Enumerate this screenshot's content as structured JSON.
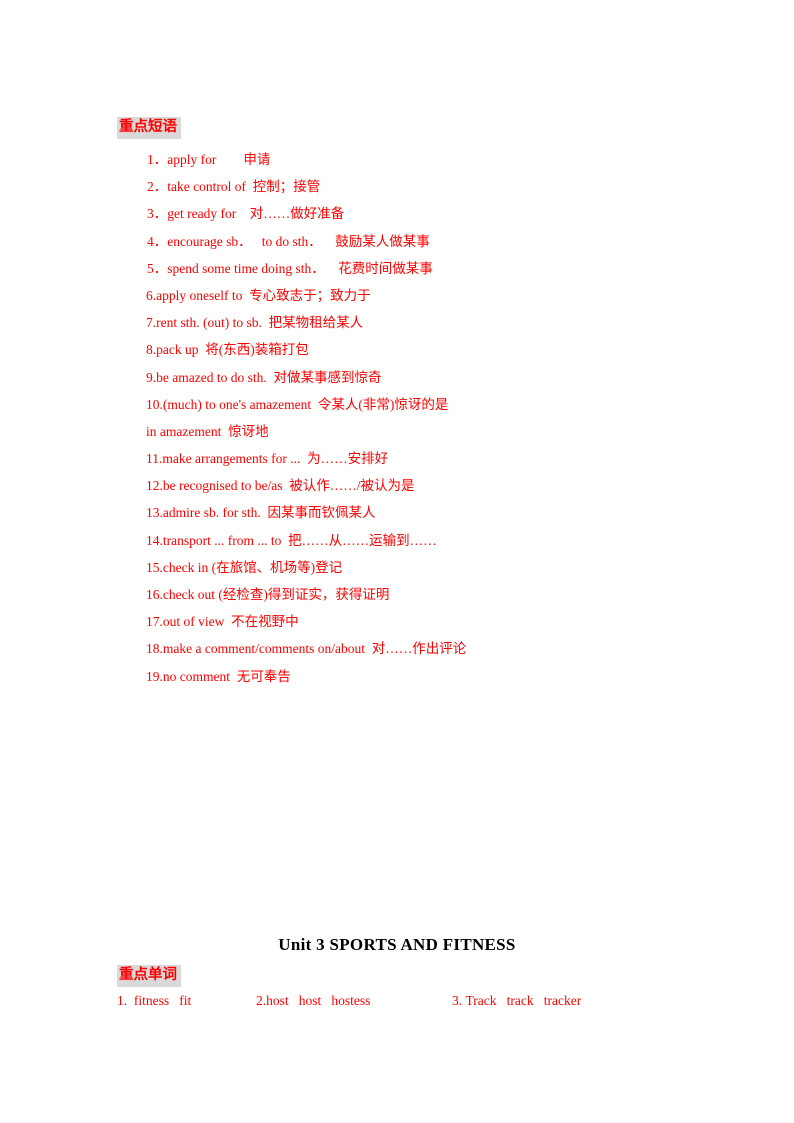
{
  "page": {
    "background": "#ffffff",
    "text_color": "#ff0000",
    "title_color": "#000000",
    "highlight_color": "#d9d9d9"
  },
  "phrases_section": {
    "heading": "重点短语",
    "items": [
      "1．apply for        申请",
      "2．take control of  控制；接管",
      "3．get ready for    对……做好准备",
      "4．encourage sb．   to do sth．    鼓励某人做某事",
      "5．spend some time doing sth．    花费时间做某事",
      "6.apply oneself to  专心致志于；致力于",
      "7.rent sth. (out) to sb.  把某物租给某人",
      "8.pack up  将(东西)装箱打包",
      "9.be amazed to do sth.  对做某事感到惊奇",
      "10.(much) to one's amazement  令某人(非常)惊讶的是",
      "in amazement  惊讶地",
      "11.make arrangements for ...  为……安排好",
      "12.be recognised to be/as  被认作……/被认为是",
      "13.admire sb. for sth.  因某事而钦佩某人",
      "14.transport ... from ... to  把……从……运输到……",
      "15.check in (在旅馆、机场等)登记",
      "16.check out (经检查)得到证实，获得证明",
      "17.out of view  不在视野中",
      "18.make a comment/comments on/about  对……作出评论",
      "19.no comment  无可奉告"
    ]
  },
  "unit": {
    "title": "Unit 3 SPORTS AND FITNESS"
  },
  "words_section": {
    "heading": "重点单词",
    "groups": [
      {
        "number": "1.",
        "words": "fitness   fit"
      },
      {
        "number": "2.",
        "words": "host   host   hostess"
      },
      {
        "number": "3.",
        "words": "Track   track   tracker"
      }
    ]
  }
}
